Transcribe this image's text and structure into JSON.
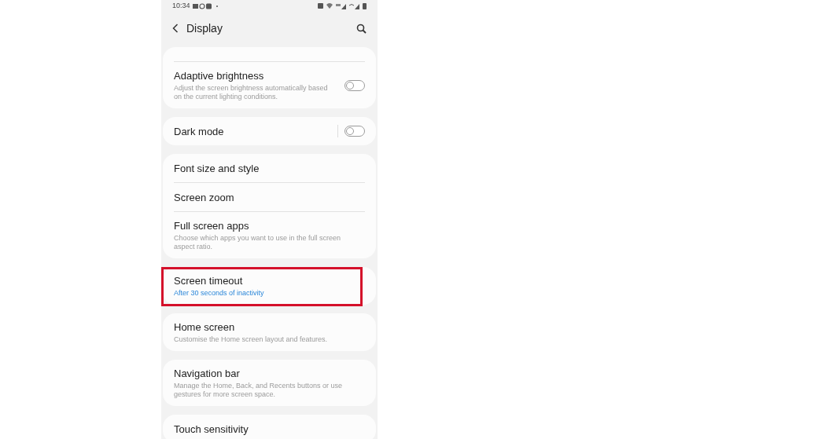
{
  "status_bar": {
    "time": "10:34"
  },
  "header": {
    "title": "Display"
  },
  "groups": [
    {
      "cut_top": true,
      "items": [
        {
          "kind": "toggle",
          "title": "Adaptive brightness",
          "subtitle": "Adjust the screen brightness automatically based on the current lighting conditions.",
          "on": false,
          "separator": false,
          "highlighted": false
        }
      ]
    },
    {
      "cut_top": false,
      "items": [
        {
          "kind": "toggle",
          "title": "Dark mode",
          "on": false,
          "separator": true,
          "highlighted": false
        }
      ]
    },
    {
      "cut_top": false,
      "items": [
        {
          "kind": "link",
          "title": "Font size and style",
          "highlighted": false
        },
        {
          "kind": "link",
          "title": "Screen zoom",
          "highlighted": false
        },
        {
          "kind": "link",
          "title": "Full screen apps",
          "subtitle": "Choose which apps you want to use in the full screen aspect ratio.",
          "highlighted": false
        }
      ]
    },
    {
      "cut_top": false,
      "items": [
        {
          "kind": "value",
          "title": "Screen timeout",
          "subtitle": "After 30 seconds of inactivity",
          "highlighted": true
        }
      ]
    },
    {
      "cut_top": false,
      "items": [
        {
          "kind": "link",
          "title": "Home screen",
          "subtitle": "Customise the Home screen layout and features.",
          "highlighted": false
        }
      ]
    },
    {
      "cut_top": false,
      "items": [
        {
          "kind": "link",
          "title": "Navigation bar",
          "subtitle": "Manage the Home, Back, and Recents buttons or use gestures for more screen space.",
          "highlighted": false
        }
      ]
    },
    {
      "cut_top": false,
      "items": [
        {
          "kind": "link",
          "title": "Touch sensitivity",
          "highlighted": false
        }
      ]
    }
  ]
}
